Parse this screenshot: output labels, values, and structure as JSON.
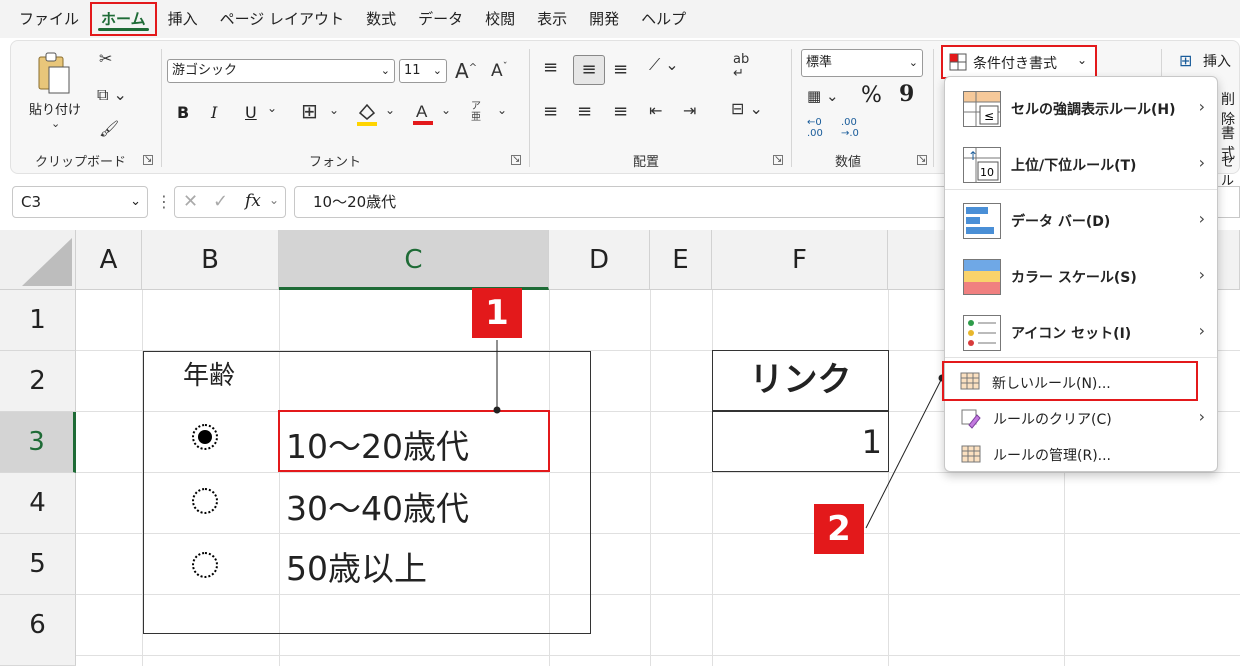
{
  "menubar": {
    "tabs": [
      "ファイル",
      "ホーム",
      "挿入",
      "ページ レイアウト",
      "数式",
      "データ",
      "校閲",
      "表示",
      "開発",
      "ヘルプ"
    ]
  },
  "ribbon": {
    "clipboard": {
      "paste": "貼り付け",
      "label": "クリップボード"
    },
    "font": {
      "name": "游ゴシック",
      "size": "11",
      "grow": "A",
      "shrink": "A",
      "bold": "B",
      "italic": "I",
      "underline": "U",
      "label": "フォント"
    },
    "align": {
      "label": "配置",
      "wrap": "ab"
    },
    "number": {
      "format": "標準",
      "percent": "%",
      "comma": "9",
      "dec_inc_top": "←0",
      "dec_inc_bot": ".00",
      "dec_dec_top": ".00",
      "dec_dec_bot": "→.0",
      "label": "数値"
    },
    "cond_format": {
      "label": "条件付き書式"
    },
    "insert": {
      "label": "挿入"
    },
    "cut_labels": [
      "削除",
      "書式",
      "セル"
    ]
  },
  "formula": {
    "namebox": "C3",
    "content": "10～20歳代",
    "fx": "fx"
  },
  "columns": [
    "A",
    "B",
    "C",
    "D",
    "E",
    "F"
  ],
  "rows": [
    "1",
    "2",
    "3",
    "4",
    "5",
    "6"
  ],
  "cells": {
    "group_title": "年齢",
    "opt1": "10～20歳代",
    "opt2": "30～40歳代",
    "opt3": "50歳以上",
    "link_header": "リンク",
    "link_value": "1"
  },
  "dropdown": {
    "items": [
      {
        "label": "セルの強調表示ルール(H)",
        "icon": "highlight-rules-icon"
      },
      {
        "label": "上位/下位ルール(T)",
        "icon": "top-bottom-icon"
      },
      {
        "label": "データ バー(D)",
        "icon": "data-bar-icon"
      },
      {
        "label": "カラー スケール(S)",
        "icon": "color-scale-icon"
      },
      {
        "label": "アイコン セット(I)",
        "icon": "icon-set-icon"
      }
    ],
    "new_rule": "新しいルール(N)...",
    "clear_rule": "ルールのクリア(C)",
    "manage_rule": "ルールの管理(R)..."
  },
  "badges": {
    "one": "1",
    "two": "2"
  },
  "colors": {
    "accent": "#1e6b36",
    "highlight": "#e3191b"
  }
}
